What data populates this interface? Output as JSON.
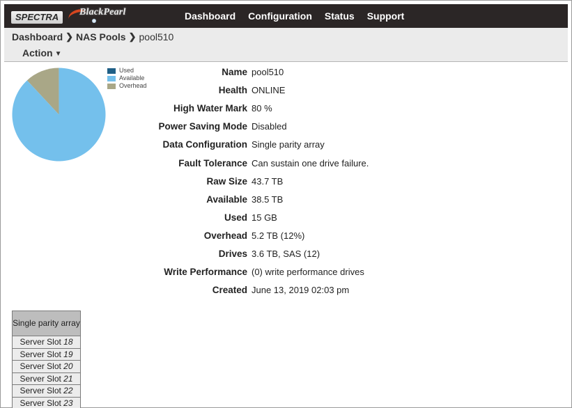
{
  "header": {
    "logo_text": "SPECTRA",
    "product_text": "BlackPearl",
    "nav": [
      "Dashboard",
      "Configuration",
      "Status",
      "Support"
    ]
  },
  "breadcrumb": {
    "items": [
      "Dashboard",
      "NAS Pools"
    ],
    "current": "pool510"
  },
  "action_menu": {
    "label": "Action"
  },
  "chart_data": {
    "type": "pie",
    "legend": [
      "Used",
      "Available",
      "Overhead"
    ],
    "values": [
      15,
      38500,
      5200
    ],
    "colors": [
      "#1f5f86",
      "#74c0ec",
      "#a9a787"
    ],
    "legend_placement": "top-right"
  },
  "details": [
    {
      "label": "Name",
      "value": "pool510"
    },
    {
      "label": "Health",
      "value": "ONLINE"
    },
    {
      "label": "High Water Mark",
      "value": "80 %"
    },
    {
      "label": "Power Saving Mode",
      "value": "Disabled"
    },
    {
      "label": "Data Configuration",
      "value": "Single parity array"
    },
    {
      "label": "Fault Tolerance",
      "value": "Can sustain one drive failure."
    },
    {
      "label": "Raw Size",
      "value": "43.7 TB"
    },
    {
      "label": "Available",
      "value": "38.5 TB"
    },
    {
      "label": "Used",
      "value": "15 GB"
    },
    {
      "label": "Overhead",
      "value": "5.2 TB (12%)"
    },
    {
      "label": "Drives",
      "value": "3.6 TB, SAS (12)"
    },
    {
      "label": "Write Performance",
      "value": "(0) write performance drives"
    },
    {
      "label": "Created",
      "value": "June 13, 2019 02:03 pm"
    }
  ],
  "slot_table": {
    "header": "Single parity array",
    "slot_prefix": "Server Slot",
    "slots": [
      "18",
      "19",
      "20",
      "21",
      "22",
      "23"
    ]
  }
}
